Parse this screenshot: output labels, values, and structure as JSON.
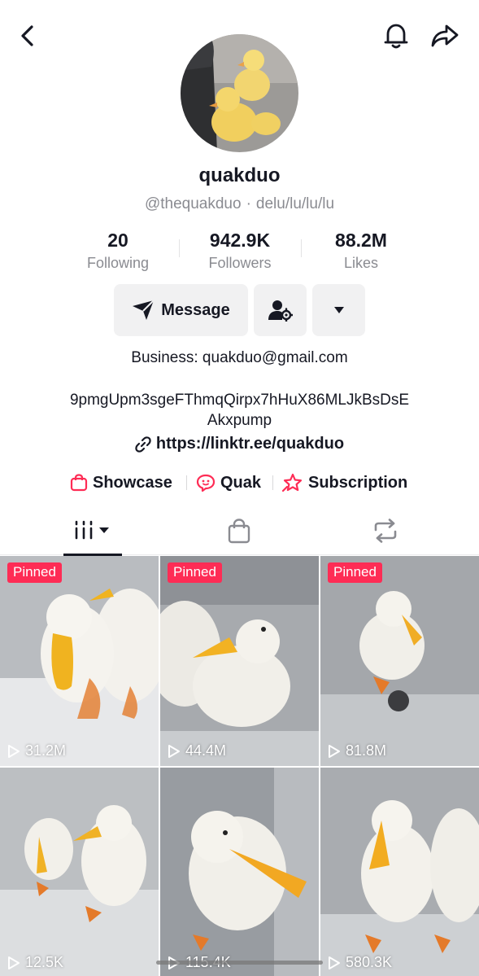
{
  "header": {
    "back_icon": "chevron-left-icon",
    "bell_icon": "bell-icon",
    "share_icon": "share-arrow-icon"
  },
  "profile": {
    "display_name": "quakduo",
    "handle": "@thequakduo",
    "separator": "·",
    "pronouns": "delu/lu/lu/lu"
  },
  "stats": [
    {
      "value": "20",
      "label": "Following"
    },
    {
      "value": "942.9K",
      "label": "Followers"
    },
    {
      "value": "88.2M",
      "label": "Likes"
    }
  ],
  "actions": {
    "message_label": "Message",
    "message_icon": "send-icon",
    "user_icon": "user-settings-icon",
    "more_icon": "caret-down-icon"
  },
  "bio": {
    "business": "Business: quakduo@gmail.com",
    "line1": "9pmgUpm3sgeFThmqQirpx7hHuX86MLJkBsDsE",
    "line2": "Akxpump",
    "link": "https://linktr.ee/quakduo",
    "link_icon": "link-icon"
  },
  "features": [
    {
      "label": "Showcase",
      "icon": "shopping-bag-icon"
    },
    {
      "label": "Quak",
      "icon": "chat-bubble-icon"
    },
    {
      "label": "Subscription",
      "icon": "star-icon"
    }
  ],
  "tabs": {
    "videos_icon": "grid-videos-icon",
    "shop_icon": "shop-bag-icon",
    "repost_icon": "repost-icon"
  },
  "videos": [
    {
      "pinned": "Pinned",
      "views": "31.2M"
    },
    {
      "pinned": "Pinned",
      "views": "44.4M"
    },
    {
      "pinned": "Pinned",
      "views": "81.8M"
    },
    {
      "views": "12.5K"
    },
    {
      "views": "115.4K"
    },
    {
      "views": "580.3K"
    }
  ],
  "colors": {
    "accent": "#fe2c55",
    "text": "#161823",
    "muted": "#8a8b91",
    "button_bg": "#f1f1f2"
  }
}
